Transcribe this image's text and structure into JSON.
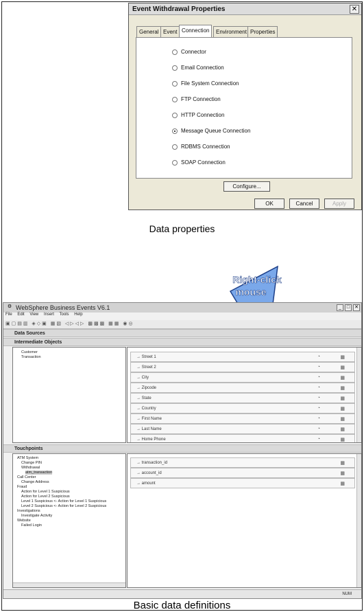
{
  "dialog": {
    "title": "Event Withdrawal Properties",
    "tabs": [
      "General",
      "Event",
      "Connection",
      "Environment",
      "Properties"
    ],
    "options": [
      "Connector",
      "Email Connection",
      "File System Connection",
      "FTP Connection",
      "HTTP Connection",
      "Message Queue Connection",
      "RDBMS Connection",
      "SOAP Connection"
    ],
    "selected_option": "Message Queue Connection",
    "configure_label": "Configure...",
    "ok_label": "OK",
    "cancel_label": "Cancel",
    "apply_label": "Apply"
  },
  "caption_top": "Data properties",
  "caption_bottom": "Basic data definitions",
  "arrow_text": [
    "Right-click",
    "mouse"
  ],
  "arrow_colors": {
    "fill": "#7aa8ea",
    "outline": "#1d3f88",
    "text": "#ffffff"
  },
  "app": {
    "title": "WebSphere Business Events V6.1",
    "menu": [
      "File",
      "Edit",
      "View",
      "Insert",
      "Tools",
      "Help"
    ],
    "sections": {
      "data_sources": "Data Sources",
      "intermediate_objects": "Intermediate Objects",
      "touchpoints": "Touchpoints"
    },
    "objects": [
      "Customer",
      "Transaction"
    ],
    "object_fields": [
      "Street 1",
      "Street 2",
      "City",
      "Zipcode",
      "State",
      "Country",
      "First Name",
      "Last Name",
      "Home Phone"
    ],
    "touchpoint_tree": [
      "ATM System",
      "Change PIN",
      "Withdrawal",
      "atm_transaction",
      "Call Center",
      "Change Address",
      "Fraud",
      "Action for Level 1 Suspicious",
      "Action for Level 2 Suspicious",
      "Level 1 Suspicious <- Action for Level 1 Suspicious",
      "Level 2 Suspicious <- Action for Level 2 Suspicious",
      "Investigations",
      "Investigate Activity",
      "Website",
      "Failed Login"
    ],
    "touchpoint_fields": [
      "transaction_id",
      "account_id",
      "amount"
    ],
    "status": "NUM"
  }
}
